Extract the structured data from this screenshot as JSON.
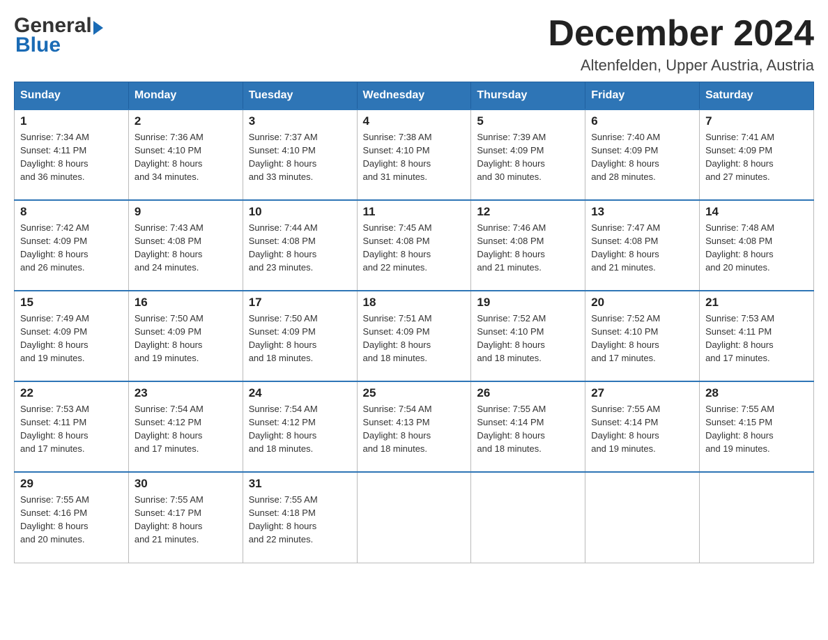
{
  "header": {
    "logo_general": "General",
    "logo_blue": "Blue",
    "month_title": "December 2024",
    "location": "Altenfelden, Upper Austria, Austria"
  },
  "weekdays": [
    "Sunday",
    "Monday",
    "Tuesday",
    "Wednesday",
    "Thursday",
    "Friday",
    "Saturday"
  ],
  "weeks": [
    [
      {
        "day": "1",
        "sunrise": "7:34 AM",
        "sunset": "4:11 PM",
        "daylight": "8 hours and 36 minutes."
      },
      {
        "day": "2",
        "sunrise": "7:36 AM",
        "sunset": "4:10 PM",
        "daylight": "8 hours and 34 minutes."
      },
      {
        "day": "3",
        "sunrise": "7:37 AM",
        "sunset": "4:10 PM",
        "daylight": "8 hours and 33 minutes."
      },
      {
        "day": "4",
        "sunrise": "7:38 AM",
        "sunset": "4:10 PM",
        "daylight": "8 hours and 31 minutes."
      },
      {
        "day": "5",
        "sunrise": "7:39 AM",
        "sunset": "4:09 PM",
        "daylight": "8 hours and 30 minutes."
      },
      {
        "day": "6",
        "sunrise": "7:40 AM",
        "sunset": "4:09 PM",
        "daylight": "8 hours and 28 minutes."
      },
      {
        "day": "7",
        "sunrise": "7:41 AM",
        "sunset": "4:09 PM",
        "daylight": "8 hours and 27 minutes."
      }
    ],
    [
      {
        "day": "8",
        "sunrise": "7:42 AM",
        "sunset": "4:09 PM",
        "daylight": "8 hours and 26 minutes."
      },
      {
        "day": "9",
        "sunrise": "7:43 AM",
        "sunset": "4:08 PM",
        "daylight": "8 hours and 24 minutes."
      },
      {
        "day": "10",
        "sunrise": "7:44 AM",
        "sunset": "4:08 PM",
        "daylight": "8 hours and 23 minutes."
      },
      {
        "day": "11",
        "sunrise": "7:45 AM",
        "sunset": "4:08 PM",
        "daylight": "8 hours and 22 minutes."
      },
      {
        "day": "12",
        "sunrise": "7:46 AM",
        "sunset": "4:08 PM",
        "daylight": "8 hours and 21 minutes."
      },
      {
        "day": "13",
        "sunrise": "7:47 AM",
        "sunset": "4:08 PM",
        "daylight": "8 hours and 21 minutes."
      },
      {
        "day": "14",
        "sunrise": "7:48 AM",
        "sunset": "4:08 PM",
        "daylight": "8 hours and 20 minutes."
      }
    ],
    [
      {
        "day": "15",
        "sunrise": "7:49 AM",
        "sunset": "4:09 PM",
        "daylight": "8 hours and 19 minutes."
      },
      {
        "day": "16",
        "sunrise": "7:50 AM",
        "sunset": "4:09 PM",
        "daylight": "8 hours and 19 minutes."
      },
      {
        "day": "17",
        "sunrise": "7:50 AM",
        "sunset": "4:09 PM",
        "daylight": "8 hours and 18 minutes."
      },
      {
        "day": "18",
        "sunrise": "7:51 AM",
        "sunset": "4:09 PM",
        "daylight": "8 hours and 18 minutes."
      },
      {
        "day": "19",
        "sunrise": "7:52 AM",
        "sunset": "4:10 PM",
        "daylight": "8 hours and 18 minutes."
      },
      {
        "day": "20",
        "sunrise": "7:52 AM",
        "sunset": "4:10 PM",
        "daylight": "8 hours and 17 minutes."
      },
      {
        "day": "21",
        "sunrise": "7:53 AM",
        "sunset": "4:11 PM",
        "daylight": "8 hours and 17 minutes."
      }
    ],
    [
      {
        "day": "22",
        "sunrise": "7:53 AM",
        "sunset": "4:11 PM",
        "daylight": "8 hours and 17 minutes."
      },
      {
        "day": "23",
        "sunrise": "7:54 AM",
        "sunset": "4:12 PM",
        "daylight": "8 hours and 17 minutes."
      },
      {
        "day": "24",
        "sunrise": "7:54 AM",
        "sunset": "4:12 PM",
        "daylight": "8 hours and 18 minutes."
      },
      {
        "day": "25",
        "sunrise": "7:54 AM",
        "sunset": "4:13 PM",
        "daylight": "8 hours and 18 minutes."
      },
      {
        "day": "26",
        "sunrise": "7:55 AM",
        "sunset": "4:14 PM",
        "daylight": "8 hours and 18 minutes."
      },
      {
        "day": "27",
        "sunrise": "7:55 AM",
        "sunset": "4:14 PM",
        "daylight": "8 hours and 19 minutes."
      },
      {
        "day": "28",
        "sunrise": "7:55 AM",
        "sunset": "4:15 PM",
        "daylight": "8 hours and 19 minutes."
      }
    ],
    [
      {
        "day": "29",
        "sunrise": "7:55 AM",
        "sunset": "4:16 PM",
        "daylight": "8 hours and 20 minutes."
      },
      {
        "day": "30",
        "sunrise": "7:55 AM",
        "sunset": "4:17 PM",
        "daylight": "8 hours and 21 minutes."
      },
      {
        "day": "31",
        "sunrise": "7:55 AM",
        "sunset": "4:18 PM",
        "daylight": "8 hours and 22 minutes."
      },
      null,
      null,
      null,
      null
    ]
  ],
  "labels": {
    "sunrise": "Sunrise:",
    "sunset": "Sunset:",
    "daylight": "Daylight:"
  }
}
